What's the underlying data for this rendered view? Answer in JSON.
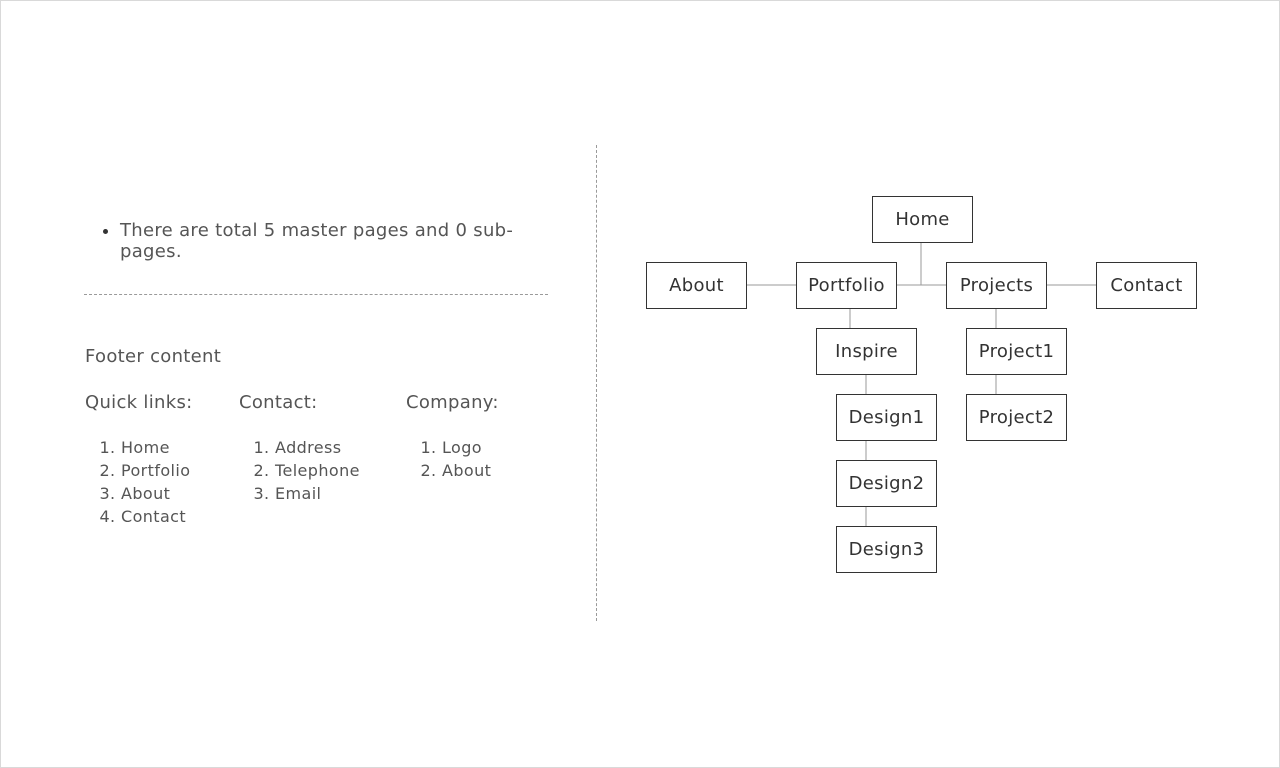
{
  "summary": {
    "text": "There are total 5 master pages and 0 sub-pages."
  },
  "footer": {
    "title": "Footer content",
    "columns": [
      {
        "title": "Quick links:",
        "items": [
          "Home",
          "Portfolio",
          "About",
          "Contact"
        ]
      },
      {
        "title": "Contact:",
        "items": [
          "Address",
          "Telephone",
          "Email"
        ]
      },
      {
        "title": "Company:",
        "items": [
          "Logo",
          "About"
        ]
      }
    ]
  },
  "sitemap": {
    "nodes": {
      "home": "Home",
      "about": "About",
      "portfolio": "Portfolio",
      "projects": "Projects",
      "contact": "Contact",
      "inspire": "Inspire",
      "design1": "Design1",
      "design2": "Design2",
      "design3": "Design3",
      "project1": "Project1",
      "project2": "Project2"
    }
  },
  "colors": {
    "node_border": "#333333",
    "connector": "#9a9a9a",
    "text": "#555555"
  }
}
